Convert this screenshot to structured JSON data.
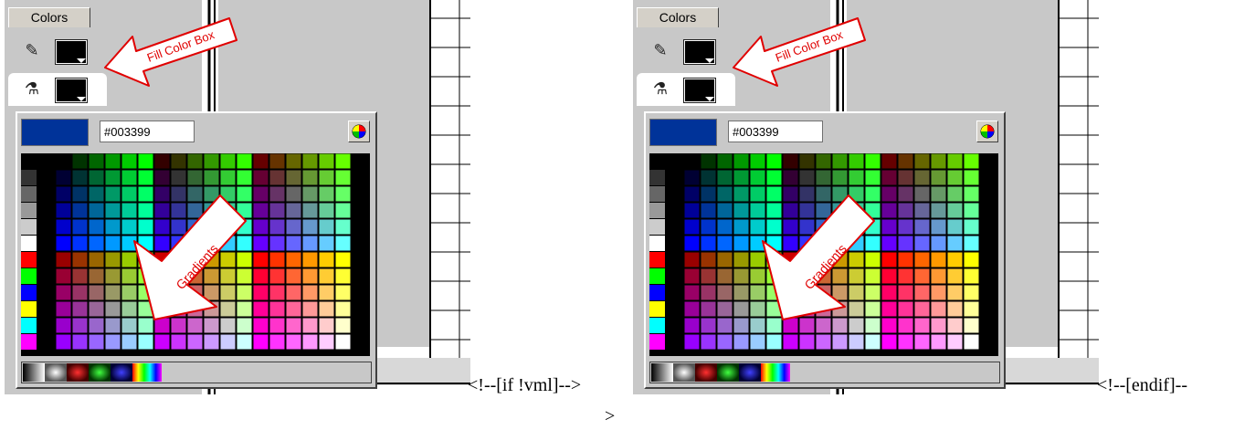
{
  "panel": {
    "tab_label": "Colors",
    "stroke_icon": "pencil-icon",
    "fill_icon": "paint-bucket-icon",
    "stroke_color": "#000000",
    "fill_color": "#000000"
  },
  "callouts": {
    "fill_color_box": "Fill Color Box",
    "gradients": "Gradients"
  },
  "popup": {
    "hex_value": "#003399",
    "current_color": "#003399",
    "wheel_icon": "color-wheel-icon",
    "gradient_swatches": [
      "black-white-linear",
      "white-radial",
      "red-radial",
      "green-radial",
      "blue-radial",
      "rainbow-linear"
    ]
  },
  "markup_comments": {
    "start": "<!--[if !vml]-->",
    "end": "<!--[endif]--",
    "tail": ">"
  }
}
